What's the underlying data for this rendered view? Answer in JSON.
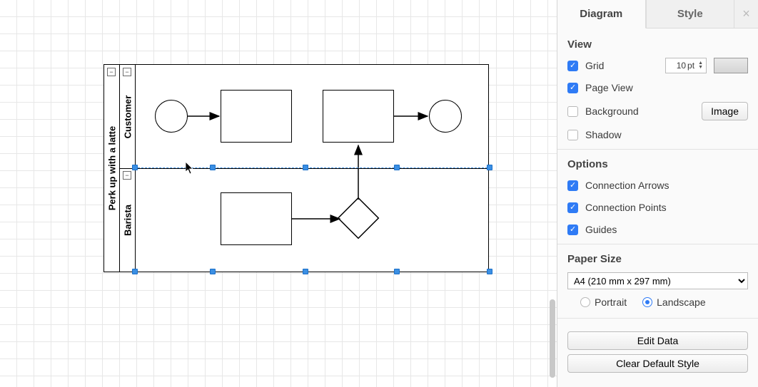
{
  "diagram": {
    "pool_title": "Perk up with a latte",
    "lane1_title": "Customer",
    "lane2_title": "Barista",
    "collapse_glyph": "−"
  },
  "sidebar": {
    "tabs": {
      "diagram": "Diagram",
      "style": "Style",
      "close": "×"
    },
    "view": {
      "heading": "View",
      "grid_label": "Grid",
      "grid_value": "10",
      "grid_unit": "pt",
      "pageview_label": "Page View",
      "background_label": "Background",
      "image_btn": "Image",
      "shadow_label": "Shadow"
    },
    "options": {
      "heading": "Options",
      "conn_arrows": "Connection Arrows",
      "conn_points": "Connection Points",
      "guides": "Guides"
    },
    "paper": {
      "heading": "Paper Size",
      "selected": "A4 (210 mm x 297 mm)",
      "portrait": "Portrait",
      "landscape": "Landscape"
    },
    "buttons": {
      "edit_data": "Edit Data",
      "clear_style": "Clear Default Style"
    }
  }
}
